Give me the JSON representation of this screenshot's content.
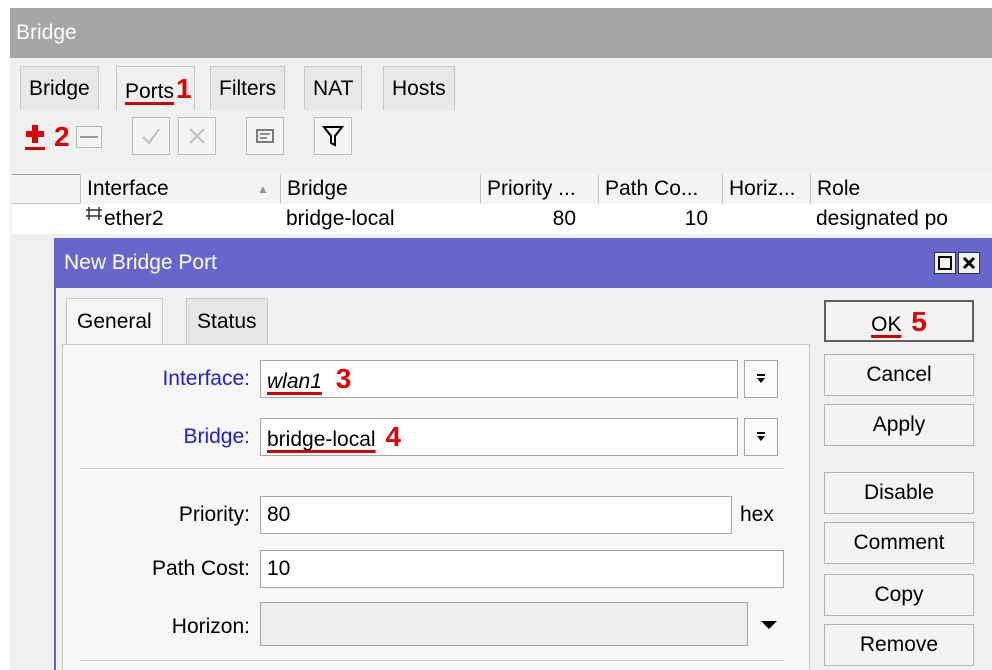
{
  "window": {
    "title": "Bridge"
  },
  "tabs": [
    {
      "label": "Bridge"
    },
    {
      "label": "Ports",
      "annotation": "1"
    },
    {
      "label": "Filters"
    },
    {
      "label": "NAT"
    },
    {
      "label": "Hosts"
    }
  ],
  "toolbar": {
    "add_annotation": "2",
    "buttons": [
      "plus-icon",
      "minus-icon",
      "check-icon",
      "cross-icon",
      "comment-icon",
      "filter-icon"
    ]
  },
  "table": {
    "columns": [
      "Interface",
      "Bridge",
      "Priority ...",
      "Path Co...",
      "Horiz...",
      "Role"
    ],
    "rows": [
      {
        "interface": "ether2",
        "bridge": "bridge-local",
        "priority": "80",
        "path_cost": "10",
        "horizon": "",
        "role": "designated po"
      }
    ]
  },
  "dialog": {
    "title": "New Bridge Port",
    "tabs": [
      "General",
      "Status"
    ],
    "fields": {
      "interface": {
        "label": "Interface:",
        "value": "wlan1",
        "annotation": "3"
      },
      "bridge": {
        "label": "Bridge:",
        "value": "bridge-local",
        "annotation": "4"
      },
      "priority": {
        "label": "Priority:",
        "value": "80",
        "suffix": "hex"
      },
      "path_cost": {
        "label": "Path Cost:",
        "value": "10"
      },
      "horizon": {
        "label": "Horizon:",
        "value": ""
      }
    },
    "buttons": {
      "ok": "OK",
      "ok_annotation": "5",
      "cancel": "Cancel",
      "apply": "Apply",
      "disable": "Disable",
      "comment": "Comment",
      "copy": "Copy",
      "remove": "Remove"
    }
  },
  "colors": {
    "annotation": "#e00000",
    "dialog_title": "#6666cc",
    "label_blue": "#2020d0"
  }
}
